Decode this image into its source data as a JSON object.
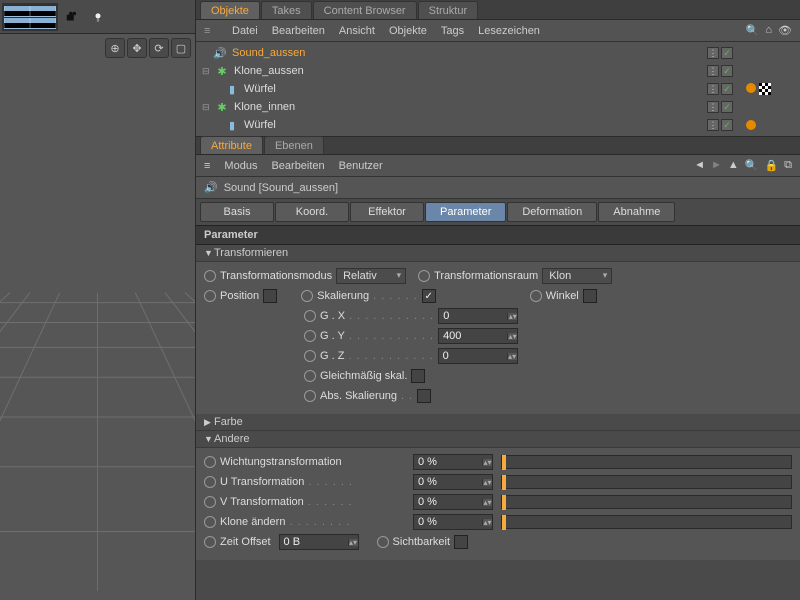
{
  "top_tabs": {
    "objekte": "Objekte",
    "takes": "Takes",
    "content": "Content Browser",
    "struktur": "Struktur"
  },
  "obj_menu": {
    "datei": "Datei",
    "bearbeiten": "Bearbeiten",
    "ansicht": "Ansicht",
    "objekte": "Objekte",
    "tags": "Tags",
    "lesezeichen": "Lesezeichen"
  },
  "tree": {
    "sound_aussen": "Sound_aussen",
    "klone_aussen": "Klone_aussen",
    "wuerfel1": "Würfel",
    "klone_innen": "Klone_innen",
    "wuerfel2": "Würfel"
  },
  "attr_tabs": {
    "attribute": "Attribute",
    "ebenen": "Ebenen"
  },
  "attr_menu": {
    "modus": "Modus",
    "bearbeiten": "Bearbeiten",
    "benutzer": "Benutzer"
  },
  "obj_title": "Sound [Sound_aussen]",
  "mode_tabs": {
    "basis": "Basis",
    "koord": "Koord.",
    "effektor": "Effektor",
    "parameter": "Parameter",
    "deformation": "Deformation",
    "abnahme": "Abnahme"
  },
  "section_parameter": "Parameter",
  "groups": {
    "transformieren": "Transformieren",
    "farbe": "Farbe",
    "andere": "Andere"
  },
  "labels": {
    "transformationsmodus": "Transformationsmodus",
    "transformationsraum": "Transformationsraum",
    "position": "Position",
    "skalierung": "Skalierung",
    "winkel": "Winkel",
    "gx": "G . X",
    "gy": "G . Y",
    "gz": "G . Z",
    "gleichmaessig": "Gleichmäßig skal.",
    "abs_skalierung": "Abs. Skalierung",
    "wichtung": "Wichtungstransformation",
    "u_trans": "U Transformation",
    "v_trans": "V Transformation",
    "klone_aendern": "Klone ändern",
    "zeit_offset": "Zeit Offset",
    "sichtbarkeit": "Sichtbarkeit"
  },
  "values": {
    "transformationsmodus": "Relativ",
    "transformationsraum": "Klon",
    "gx": "0",
    "gy": "400",
    "gz": "0",
    "wichtung": "0 %",
    "u_trans": "0 %",
    "v_trans": "0 %",
    "klone_aendern": "0 %",
    "zeit_offset": "0 B"
  },
  "vis_check": "✓"
}
